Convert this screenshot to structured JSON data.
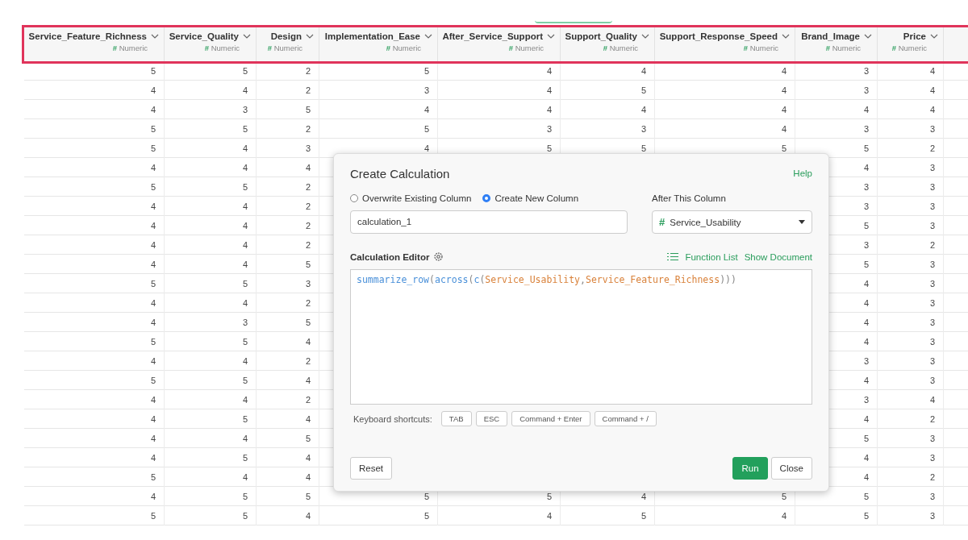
{
  "table": {
    "columns": [
      {
        "name": "Service_Feature_Richness",
        "type_icon": "#",
        "type": "Numeric"
      },
      {
        "name": "Service_Quality",
        "type_icon": "#",
        "type": "Numeric"
      },
      {
        "name": "Design",
        "type_icon": "#",
        "type": "Numeric"
      },
      {
        "name": "Implementation_Ease",
        "type_icon": "#",
        "type": "Numeric"
      },
      {
        "name": "After_Service_Support",
        "type_icon": "#",
        "type": "Numeric"
      },
      {
        "name": "Support_Quality",
        "type_icon": "#",
        "type": "Numeric"
      },
      {
        "name": "Support_Response_Speed",
        "type_icon": "#",
        "type": "Numeric"
      },
      {
        "name": "Brand_Image",
        "type_icon": "#",
        "type": "Numeric"
      },
      {
        "name": "Price",
        "type_icon": "#",
        "type": "Numeric"
      }
    ],
    "rows": [
      [
        "5",
        "5",
        "2",
        "5",
        "4",
        "4",
        "4",
        "3",
        "4"
      ],
      [
        "4",
        "4",
        "2",
        "3",
        "4",
        "5",
        "4",
        "3",
        "4"
      ],
      [
        "4",
        "3",
        "5",
        "4",
        "4",
        "4",
        "4",
        "4",
        "4"
      ],
      [
        "5",
        "5",
        "2",
        "5",
        "3",
        "3",
        "4",
        "3",
        "3"
      ],
      [
        "5",
        "4",
        "3",
        "4",
        "5",
        "5",
        "5",
        "5",
        "2"
      ],
      [
        "4",
        "4",
        "4",
        null,
        null,
        null,
        null,
        "4",
        "3"
      ],
      [
        "5",
        "5",
        "2",
        null,
        null,
        null,
        null,
        "3",
        "3"
      ],
      [
        "4",
        "4",
        "2",
        null,
        null,
        null,
        null,
        "3",
        "3"
      ],
      [
        "4",
        "4",
        "2",
        null,
        null,
        null,
        null,
        "5",
        "3"
      ],
      [
        "4",
        "4",
        "2",
        null,
        null,
        null,
        null,
        "3",
        "2"
      ],
      [
        "4",
        "4",
        "5",
        null,
        null,
        null,
        null,
        "5",
        "3"
      ],
      [
        "5",
        "5",
        "3",
        null,
        null,
        null,
        null,
        "4",
        "3"
      ],
      [
        "4",
        "4",
        "2",
        null,
        null,
        null,
        null,
        "4",
        "3"
      ],
      [
        "4",
        "3",
        "5",
        null,
        null,
        null,
        null,
        "4",
        "3"
      ],
      [
        "5",
        "5",
        "4",
        null,
        null,
        null,
        null,
        "4",
        "3"
      ],
      [
        "4",
        "4",
        "2",
        null,
        null,
        null,
        null,
        "3",
        "3"
      ],
      [
        "5",
        "5",
        "4",
        null,
        null,
        null,
        null,
        "4",
        "3"
      ],
      [
        "4",
        "4",
        "2",
        null,
        null,
        null,
        null,
        "3",
        "4"
      ],
      [
        "4",
        "5",
        "4",
        null,
        null,
        null,
        null,
        "4",
        "2"
      ],
      [
        "4",
        "4",
        "5",
        null,
        null,
        null,
        null,
        "5",
        "3"
      ],
      [
        "4",
        "5",
        "4",
        null,
        null,
        null,
        null,
        "4",
        "3"
      ],
      [
        "5",
        "4",
        "4",
        null,
        null,
        null,
        null,
        "4",
        "2"
      ],
      [
        "4",
        "5",
        "5",
        "5",
        "5",
        "4",
        "5",
        "5",
        "3"
      ],
      [
        "5",
        "5",
        "4",
        "5",
        "4",
        "5",
        "4",
        "5",
        "3"
      ]
    ]
  },
  "dialog": {
    "title": "Create Calculation",
    "help": "Help",
    "modes": [
      {
        "label": "Overwrite Existing Column",
        "selected": false
      },
      {
        "label": "Create New Column",
        "selected": true
      }
    ],
    "new_column_name": "calculation_1",
    "after_label": "After This Column",
    "after_column": {
      "type_icon": "#",
      "value": "Service_Usability"
    },
    "editor_label": "Calculation Editor",
    "function_list": "Function List",
    "show_document": "Show Document",
    "code": [
      {
        "text": "summarize_row",
        "kind": "func"
      },
      {
        "text": "(",
        "kind": "punct"
      },
      {
        "text": "across",
        "kind": "func"
      },
      {
        "text": "(",
        "kind": "punct"
      },
      {
        "text": "c",
        "kind": "func"
      },
      {
        "text": "(",
        "kind": "punct"
      },
      {
        "text": "Service_Usability",
        "kind": "column"
      },
      {
        "text": ",",
        "kind": "punct"
      },
      {
        "text": "Service_Feature_Richness",
        "kind": "column"
      },
      {
        "text": ")))",
        "kind": "punct"
      }
    ],
    "shortcuts_label": "Keyboard shortcuts:",
    "shortcuts": [
      "TAB",
      "ESC",
      "Command + Enter",
      "Command + /"
    ],
    "reset": "Reset",
    "run": "Run",
    "close": "Close"
  }
}
